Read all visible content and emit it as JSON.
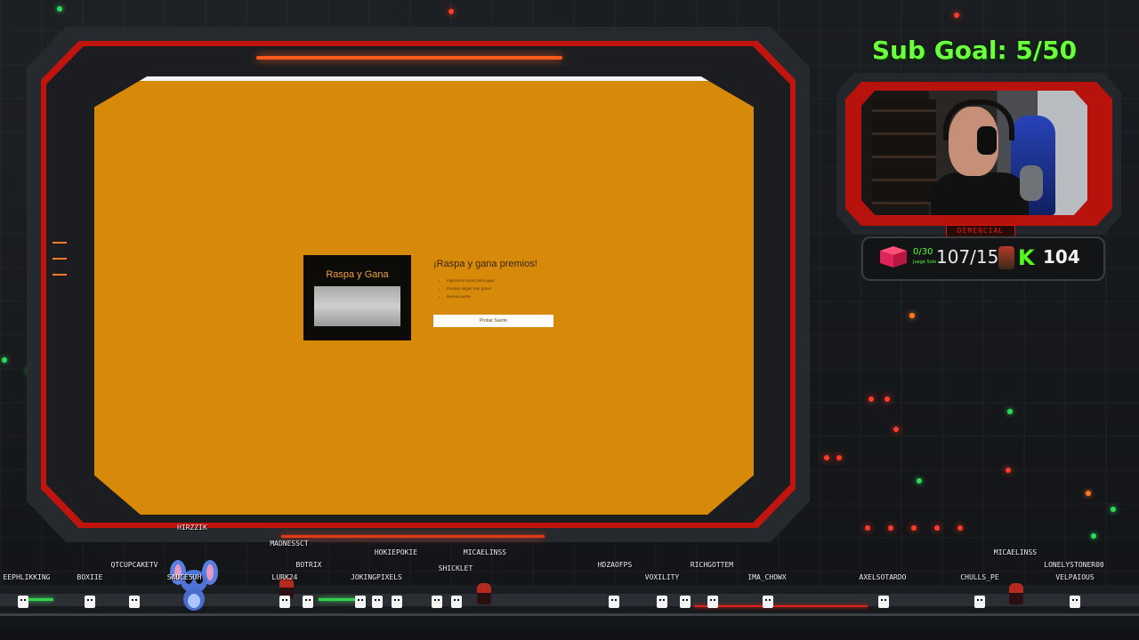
{
  "stream_overlay": {
    "sub_goal": "Sub Goal: 5/50",
    "cam_label": "DEMENCIAL",
    "juego_count": "0/30",
    "juego_label": "Juego Solo",
    "followers": "107/150",
    "kick_count": "104",
    "accent_green": "#6bff3d",
    "accent_red": "#c0150f"
  },
  "browser_page": {
    "card_title": "Raspa y Gana",
    "heading": "¡Raspa y gana premios!",
    "list_items": [
      "Ingresa tu email para jugar",
      "Puedes seguir tras ganar",
      "Buena suerte"
    ],
    "button_label": "Probar Suerte",
    "background_color": "#d78a0a"
  },
  "chat_avatars": [
    {
      "name": "EEPHLIKKING"
    },
    {
      "name": "BOXIIE"
    },
    {
      "name": "QTCUPCAKETV"
    },
    {
      "name": "SAUCESUH"
    },
    {
      "name": "HIRZZIK"
    },
    {
      "name": "MADNESSCT"
    },
    {
      "name": "BOTRIX"
    },
    {
      "name": "LURK24"
    },
    {
      "name": "HOKIEPOKIE"
    },
    {
      "name": "JOKINGPIXELS"
    },
    {
      "name": "MICAELINSS"
    },
    {
      "name": "SHICKLET"
    },
    {
      "name": "HDZAOFPS"
    },
    {
      "name": "VOXILITY"
    },
    {
      "name": "RICHGOTTEM"
    },
    {
      "name": "IMA_CHOWX"
    },
    {
      "name": "AXELSOTARDO"
    },
    {
      "name": "CHULLS_PE"
    },
    {
      "name": "MICAELINSS"
    },
    {
      "name": "LONELYSTONER00"
    },
    {
      "name": "VELPAIOUS"
    }
  ]
}
